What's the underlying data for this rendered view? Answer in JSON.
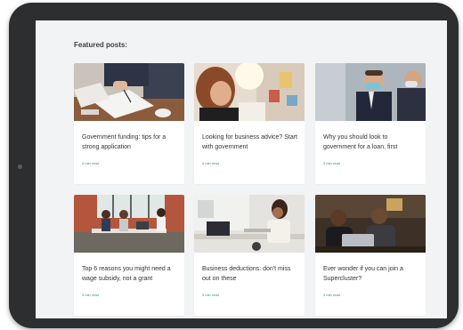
{
  "section_heading": "Featured posts:",
  "posts": [
    {
      "title": "Government funding: tips for a strong application",
      "read_time": "4 min read",
      "image": "signing-documents-photo"
    },
    {
      "title": "Looking for business advice? Start with government",
      "read_time": "4 min read",
      "image": "meeting-advice-photo"
    },
    {
      "title": "Why you should look to government for a loan, first",
      "read_time": "3 min read",
      "image": "masked-businessmen-photo"
    },
    {
      "title": "Top 6 reasons you might need a wage subsidy, not a grant",
      "read_time": "3 min read",
      "image": "office-team-photo"
    },
    {
      "title": "Business deductions: don't miss out on these",
      "read_time": "3 min read",
      "image": "desk-worker-photo"
    },
    {
      "title": "Ever wonder if you can join a Supercluster?",
      "read_time": "3 min read",
      "image": "laptop-colleagues-photo"
    }
  ],
  "colors": {
    "accent": "#2f8d7f",
    "device_frame": "#2c2e30",
    "screen_bg": "#f2f3f4"
  }
}
